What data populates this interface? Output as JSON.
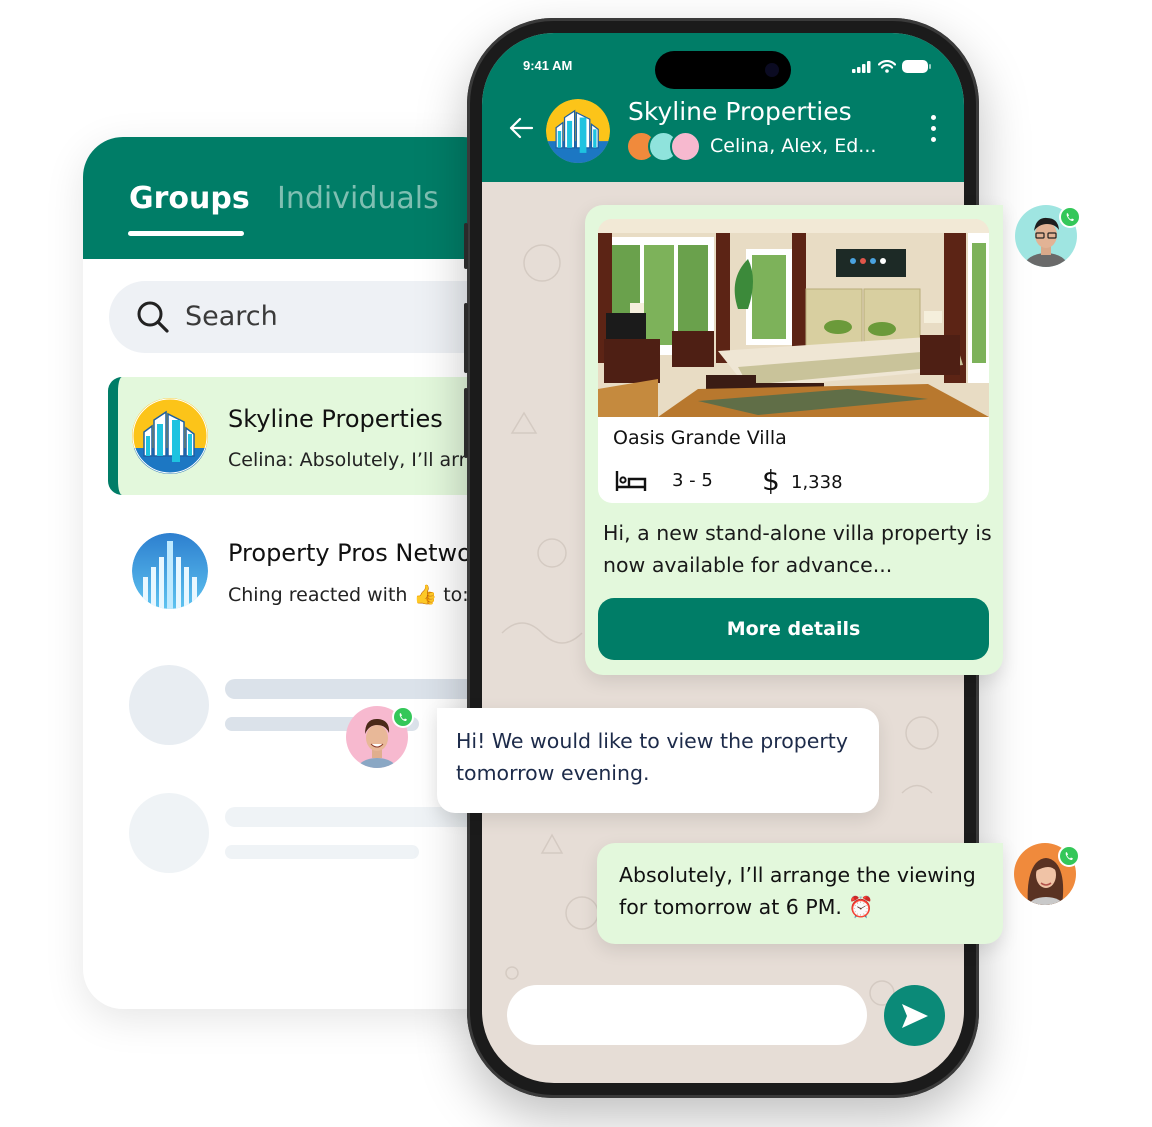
{
  "groups_panel": {
    "tabs": [
      {
        "label": "Groups",
        "active": true
      },
      {
        "label": "Individuals",
        "active": false
      }
    ],
    "search": {
      "placeholder": "Search",
      "icon": "search-icon"
    },
    "chats": [
      {
        "name": "Skyline Properties",
        "preview": "Celina: Absolutely, I’ll arra",
        "active": true,
        "avatar": "skyline-logo"
      },
      {
        "name": "Property Pros Netwo",
        "preview": "Ching reacted with 👍 to:",
        "active": false,
        "avatar": "property-pros-logo"
      }
    ]
  },
  "phone": {
    "status_bar": {
      "time": "9:41 AM",
      "icons": [
        "signal-icon",
        "wifi-icon",
        "battery-icon"
      ]
    },
    "chat_header": {
      "title": "Skyline Properties",
      "members": "Celina, Alex, Ed...",
      "back_icon": "back-arrow-icon",
      "menu_icon": "more-vertical-icon"
    },
    "composer": {
      "placeholder": "",
      "send_icon": "send-icon"
    }
  },
  "messages": [
    {
      "type": "property-card",
      "direction": "outgoing",
      "property": {
        "name": "Oasis Grande Villa",
        "rooms": "3 - 5",
        "currency_symbol": "$",
        "price": "1,338"
      },
      "text": "Hi, a new stand-alone villa property is now available for advance...",
      "button_label": "More details"
    },
    {
      "type": "text",
      "direction": "incoming",
      "text": "Hi! We would like to view the property tomorrow evening."
    },
    {
      "type": "text",
      "direction": "outgoing",
      "text": "Absolutely, I’ll arrange the viewing for tomorrow at 6 PM. ⏰"
    }
  ],
  "colors": {
    "brand": "#007d67",
    "outgoing_bubble": "#e3f8dc",
    "incoming_bubble": "#ffffff",
    "chat_background": "#e6ddd6",
    "whatsapp_badge": "#34c759",
    "send_button": "#0b8a78"
  }
}
